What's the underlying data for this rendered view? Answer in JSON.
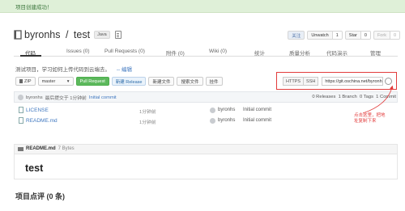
{
  "flash": {
    "message": "项目创建成功！"
  },
  "repo": {
    "owner": "byronhs",
    "separator": " / ",
    "name": "test",
    "language": "Java"
  },
  "actions": {
    "watch_label": "关注",
    "unwatch_label": "Unwatch",
    "unwatch_count": "1",
    "star_label": "Star",
    "star_count": "0",
    "fork_label": "Fork",
    "fork_count": "0"
  },
  "tabs": [
    "代码",
    "Issues (0)",
    "Pull Requests (0)",
    "附件 (0)",
    "Wiki (0)",
    "统计",
    "质量分析",
    "代码演示",
    "管理"
  ],
  "description": {
    "text": "测试项目，学习如何上传代码到云端去。",
    "edit_label": "-- 编辑"
  },
  "toolbar": {
    "zip": "ZIP",
    "branch": "master",
    "pull_request": "Pull Request",
    "new_release": "新建 Release",
    "new_file": "新建文件",
    "search_file": "搜索文件",
    "upload": "挂件"
  },
  "clone": {
    "https": "HTTPS",
    "ssh": "SSH",
    "url": "https://git.oschina.net/byronhs/test.git"
  },
  "latest_commit": {
    "author": "byronhs",
    "prefix": "最后提交于 1分钟前",
    "message": "Initial commit",
    "stats": "0 Releases  1 Branch  0 Tags  1 Commit"
  },
  "files": [
    {
      "name": "LICENSE",
      "time": "1分钟前",
      "author": "byronhs",
      "message": "Initial commit"
    },
    {
      "name": "README.md",
      "time": "1分钟前",
      "author": "byronhs",
      "message": "Initial commit"
    }
  ],
  "callout": {
    "text": "点击这里，把地址复制下来",
    "color": "#e23c3c"
  },
  "readme": {
    "filename": "README.md",
    "size": "7 Bytes",
    "heading": "test"
  },
  "comments": {
    "title": "项目点评 (0 条)"
  },
  "colors": {
    "accent": "#4078c0",
    "success": "#5cb85c",
    "annotation": "#e23c3c"
  }
}
